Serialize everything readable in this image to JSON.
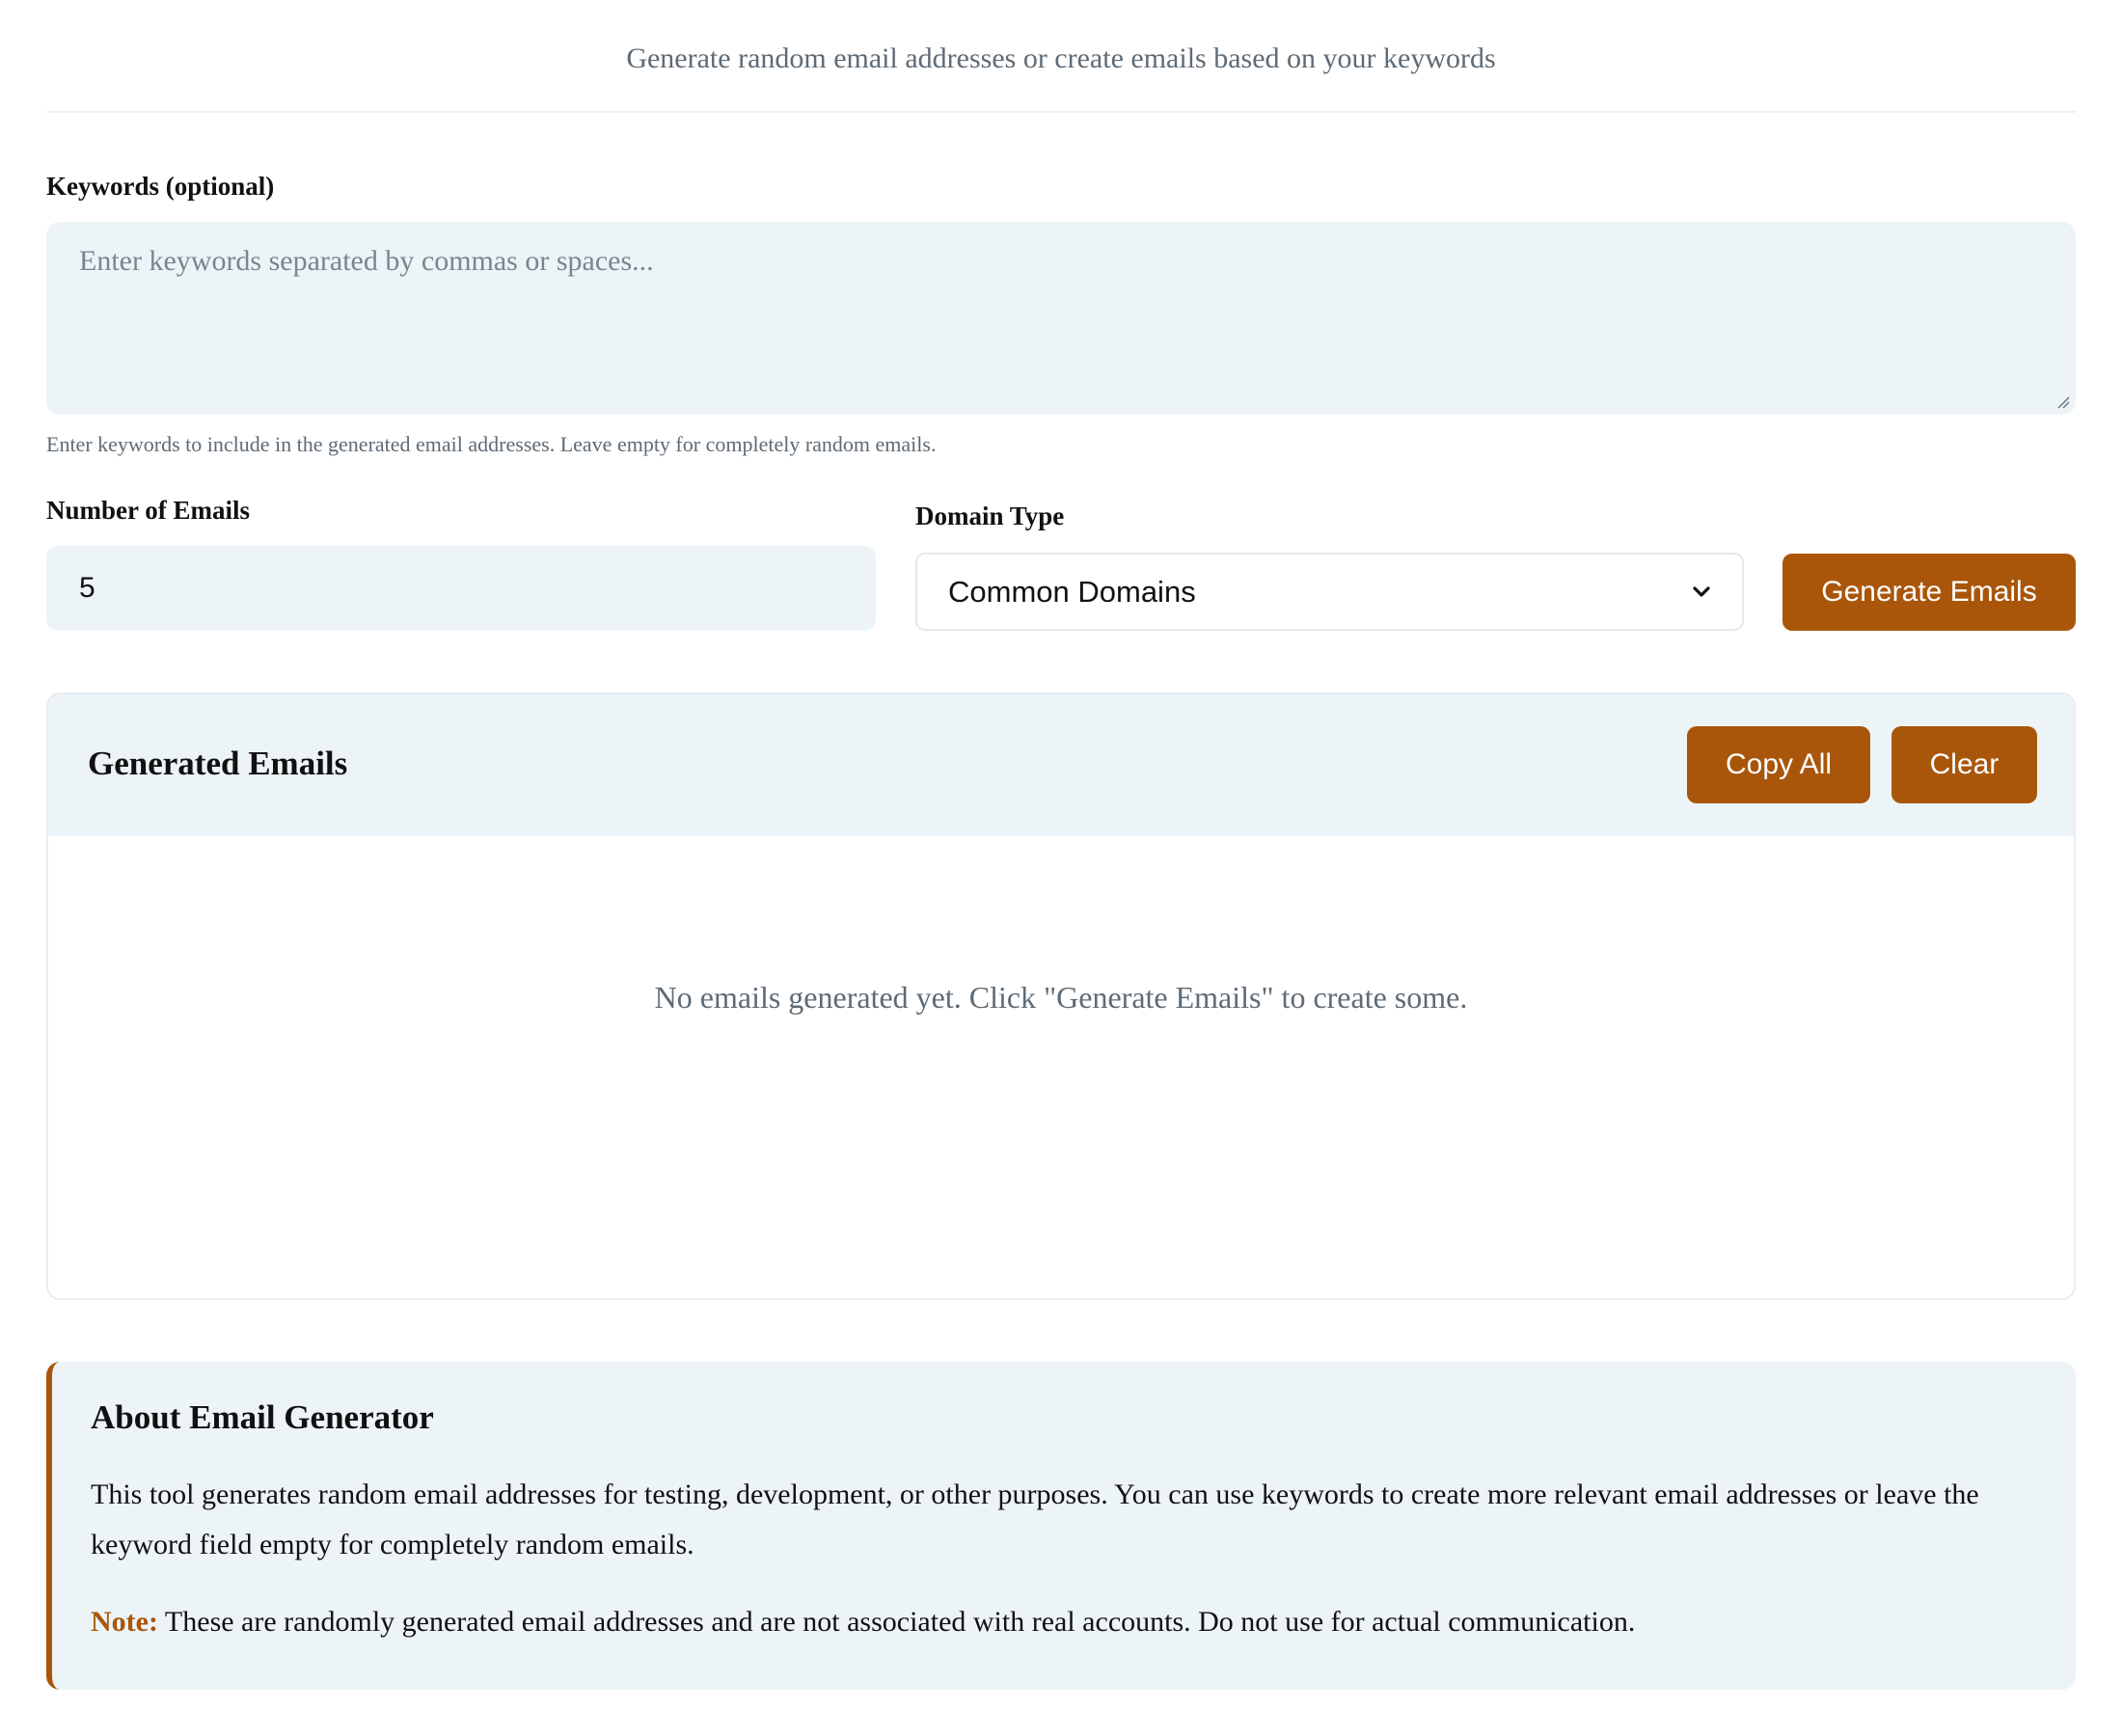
{
  "header": {
    "subtitle": "Generate random email addresses or create emails based on your keywords"
  },
  "keywords": {
    "label": "Keywords (optional)",
    "placeholder": "Enter keywords separated by commas or spaces...",
    "value": "",
    "help_text": "Enter keywords to include in the generated email addresses. Leave empty for completely random emails."
  },
  "count": {
    "label": "Number of Emails",
    "value": "5"
  },
  "domain_type": {
    "label": "Domain Type",
    "selected": "Common Domains"
  },
  "actions": {
    "generate_label": "Generate Emails"
  },
  "results": {
    "title": "Generated Emails",
    "copy_label": "Copy All",
    "clear_label": "Clear",
    "empty_message": "No emails generated yet. Click \"Generate Emails\" to create some."
  },
  "about": {
    "title": "About Email Generator",
    "body": "This tool generates random email addresses for testing, development, or other purposes. You can use keywords to create more relevant email addresses or leave the keyword field empty for completely random emails.",
    "note_label": "Note:",
    "note_text": " These are randomly generated email addresses and are not associated with real accounts. Do not use for actual communication."
  },
  "colors": {
    "accent": "#a9560a",
    "panel_background": "#ecf4f8",
    "muted_text": "#5f6b75"
  }
}
